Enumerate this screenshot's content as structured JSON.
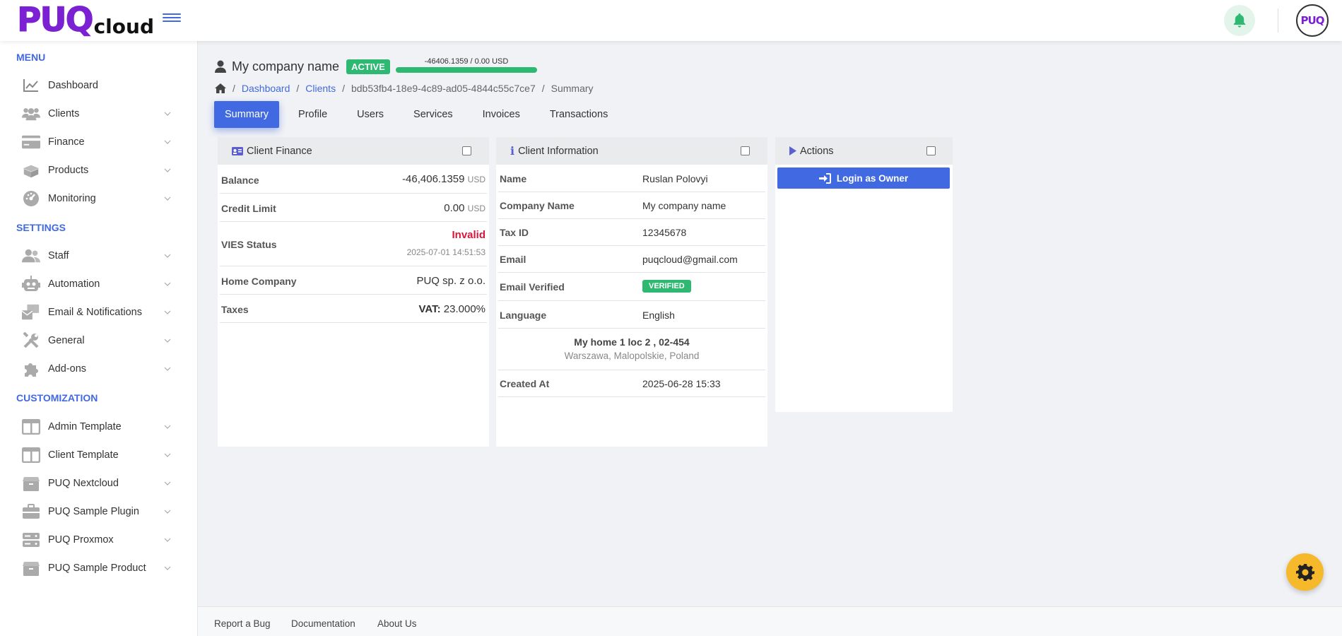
{
  "logo": {
    "part1": "PUQ",
    "part2": "cloud"
  },
  "avatar": {
    "text": "PUQ"
  },
  "sidebar": {
    "menu_title": "MENU",
    "menu_items": [
      {
        "label": "Dashboard",
        "icon": "chart-line-icon"
      },
      {
        "label": "Clients",
        "icon": "users-icon"
      },
      {
        "label": "Finance",
        "icon": "credit-card-icon"
      },
      {
        "label": "Products",
        "icon": "box-icon"
      },
      {
        "label": "Monitoring",
        "icon": "gauge-icon"
      }
    ],
    "settings_title": "SETTINGS",
    "settings_items": [
      {
        "label": "Staff",
        "icon": "user-group-icon"
      },
      {
        "label": "Automation",
        "icon": "robot-icon"
      },
      {
        "label": "Email & Notifications",
        "icon": "mail-bulk-icon"
      },
      {
        "label": "General",
        "icon": "tools-icon"
      },
      {
        "label": "Add-ons",
        "icon": "puzzle-icon"
      }
    ],
    "customization_title": "CUSTOMIZATION",
    "customization_items": [
      {
        "label": "Admin Template",
        "icon": "layout-icon"
      },
      {
        "label": "Client Template",
        "icon": "layout-icon"
      },
      {
        "label": "PUQ Nextcloud",
        "icon": "box-icon"
      },
      {
        "label": "PUQ Sample Plugin",
        "icon": "briefcase-icon"
      },
      {
        "label": "PUQ Proxmox",
        "icon": "server-icon"
      },
      {
        "label": "PUQ Sample Product",
        "icon": "box-icon"
      }
    ]
  },
  "client": {
    "name": "My company name",
    "status": "ACTIVE",
    "balance_summary": "-46406.1359 / 0.00 USD",
    "balance_fill": 1.0
  },
  "breadcrumb": {
    "dashboard": "Dashboard",
    "clients": "Clients",
    "uuid": "bdb53fb4-18e9-4c89-ad05-4844c55c7ce7",
    "current": "Summary",
    "separator": "/"
  },
  "tabs": [
    "Summary",
    "Profile",
    "Users",
    "Services",
    "Invoices",
    "Transactions"
  ],
  "finance": {
    "title": "Client Finance",
    "balance_label": "Balance",
    "balance_value": "-46,406.1359",
    "balance_unit": "USD",
    "credit_label": "Credit Limit",
    "credit_value": "0.00",
    "credit_unit": "USD",
    "vies_label": "VIES Status",
    "vies_value": "Invalid",
    "vies_date": "2025-07-01 14:51:53",
    "home_label": "Home Company",
    "home_value": "PUQ sp. z o.o.",
    "taxes_label": "Taxes",
    "taxes_name": "VAT:",
    "taxes_value": "23.000%"
  },
  "info": {
    "title": "Client Information",
    "rows": [
      {
        "label": "Name",
        "value": "Ruslan Polovyi"
      },
      {
        "label": "Company Name",
        "value": "My company name"
      },
      {
        "label": "Tax ID",
        "value": "12345678"
      },
      {
        "label": "Email",
        "value": "puqcloud@gmail.com"
      }
    ],
    "verified_label": "Email Verified",
    "verified_badge": "VERIFIED",
    "language_label": "Language",
    "language_value": "English",
    "address_line1": "My home 1 loc 2 , 02-454",
    "address_line2": "Warszawa, Malopolskie, Poland",
    "created_label": "Created At",
    "created_value": "2025-06-28 15:33"
  },
  "actions": {
    "title": "Actions",
    "login_label": "Login as Owner"
  },
  "footer": {
    "report": "Report a Bug",
    "docs": "Documentation",
    "about": "About Us"
  },
  "colors": {
    "accent": "#4169e1",
    "success": "#2eb872",
    "danger": "#dc143c",
    "brand": "#7b21d3",
    "fab": "#f6b92b"
  }
}
